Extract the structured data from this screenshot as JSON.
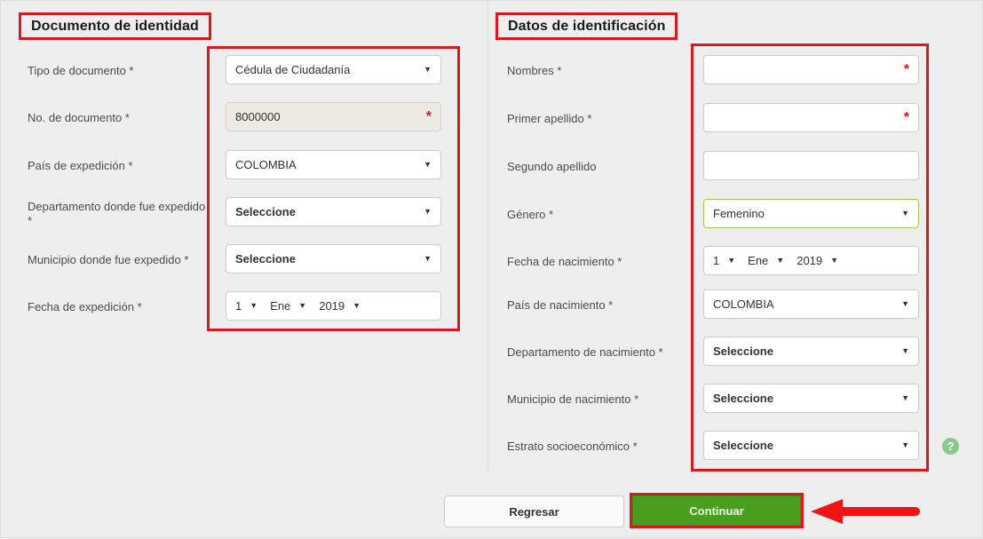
{
  "theme": {
    "page_background": "#eeeeee",
    "highlight_red": "#d71920",
    "primary_green": "#4a9e1f",
    "valid_border_green": "#a2c653",
    "help_icon_green": "#8cc78c",
    "label_color": "#4c4c4c"
  },
  "sections": {
    "left": {
      "title": "Documento de identidad",
      "fields": [
        {
          "label": "Tipo de documento *",
          "type": "select",
          "value": "Cédula de Ciudadanía"
        },
        {
          "label": "No. de documento *",
          "type": "text-disabled",
          "value": "8000000",
          "required_mark": "*"
        },
        {
          "label": "País de expedición *",
          "type": "select",
          "value": "COLOMBIA"
        },
        {
          "label": "Departamento donde fue expedido *",
          "type": "select",
          "value": "Seleccione"
        },
        {
          "label": "Municipio donde fue expedido *",
          "type": "select",
          "value": "Seleccione"
        },
        {
          "label": "Fecha de expedición *",
          "type": "date",
          "day": "1",
          "month": "Ene",
          "year": "2019"
        }
      ]
    },
    "right": {
      "title": "Datos de identificación",
      "fields": [
        {
          "label": "Nombres *",
          "type": "text",
          "value": "",
          "required_mark": "*"
        },
        {
          "label": "Primer apellido *",
          "type": "text",
          "value": "",
          "required_mark": "*"
        },
        {
          "label": "Segundo apellido",
          "type": "text",
          "value": ""
        },
        {
          "label": "Género *",
          "type": "select",
          "value": "Femenino",
          "state": "valid"
        },
        {
          "label": "Fecha de nacimiento *",
          "type": "date",
          "day": "1",
          "month": "Ene",
          "year": "2019"
        },
        {
          "label": "País de nacimiento *",
          "type": "select",
          "value": "COLOMBIA"
        },
        {
          "label": "Departamento de nacimiento *",
          "type": "select",
          "value": "Seleccione"
        },
        {
          "label": "Municipio de nacimiento *",
          "type": "select",
          "value": "Seleccione"
        },
        {
          "label": "Estrato socioeconómico *",
          "type": "select",
          "value": "Seleccione"
        }
      ]
    }
  },
  "icons": {
    "caret_down": "▼",
    "help": "?"
  },
  "footer": {
    "back_label": "Regresar",
    "continue_label": "Continuar"
  }
}
